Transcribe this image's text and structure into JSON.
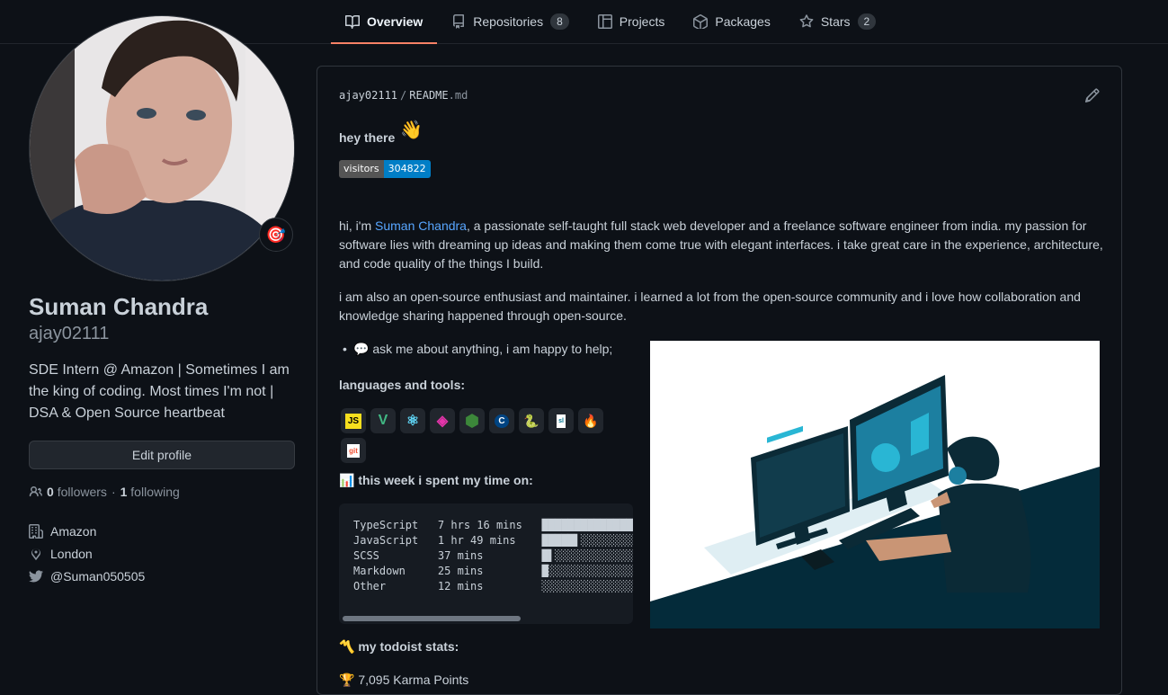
{
  "tabs": [
    {
      "label": "Overview",
      "icon": "book-icon",
      "active": true
    },
    {
      "label": "Repositories",
      "icon": "repo-icon",
      "count": "8"
    },
    {
      "label": "Projects",
      "icon": "project-icon"
    },
    {
      "label": "Packages",
      "icon": "package-icon"
    },
    {
      "label": "Stars",
      "icon": "star-icon",
      "count": "2"
    }
  ],
  "profile": {
    "name": "Suman Chandra",
    "login": "ajay02111",
    "status_emoji": "🎯",
    "bio": "SDE Intern @ Amazon | Sometimes I am the king of coding. Most times I'm not | DSA & Open Source heartbeat",
    "edit_label": "Edit profile",
    "followers_count": "0",
    "followers_label": "followers",
    "separator": "·",
    "following_count": "1",
    "following_label": "following",
    "company": "Amazon",
    "location": "London",
    "twitter": "@Suman050505"
  },
  "readme": {
    "owner": "ajay02111",
    "slash": "/",
    "file_base": "README",
    "file_ext": ".md",
    "greeting": "hey there",
    "wave": "👋",
    "badge_label": "visitors",
    "badge_value": "304822",
    "intro_pre": "hi, i'm ",
    "intro_link": "Suman Chandra",
    "intro_post": ", a passionate self-taught full stack web developer and a freelance software engineer from india. my passion for software lies with dreaming up ideas and making them come true with elegant interfaces. i take great care in the experience, architecture, and code quality of the things I build.",
    "para2": "i am also an open-source enthusiast and maintainer. i learned a lot from the open-source community and i love how collaboration and knowledge sharing happened through open-source.",
    "bullet": "💬 ask me about anything, i am happy to help;",
    "tools_heading": "languages and tools:",
    "tools": [
      "JS",
      "V",
      "⚛",
      "◈",
      "⬢",
      "C",
      "🐍",
      "sl",
      "🔥",
      "git"
    ],
    "week_heading": "📊 this week i spent my time on:",
    "wakatime": "TypeScript   7 hrs 16 mins   ██████████████████████▌░░░\nJavaScript   1 hr 49 mins    █████▌░░░░░░░░░░░░░░░░░░░░\nSCSS         37 mins         █▌░░░░░░░░░░░░░░░░░░░░░░░░\nMarkdown     25 mins         █░░░░░░░░░░░░░░░░░░░░░░░░░\nOther        12 mins         ░░░░░░░░░░░░░░░░░░░░░░░░░░",
    "todoist_heading": "〽️ my todoist stats:",
    "karma": "🏆 7,095 Karma Points"
  }
}
